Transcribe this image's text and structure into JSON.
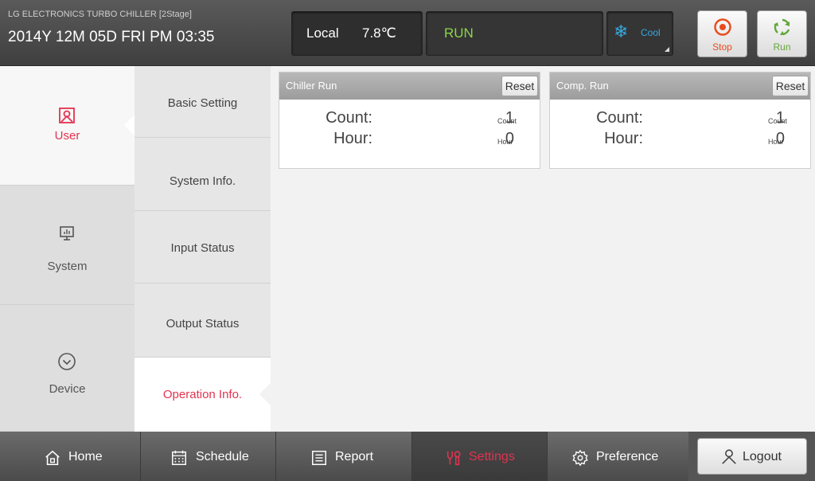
{
  "header": {
    "device_title": "LG ELECTRONICS TURBO CHILLER [2Stage]",
    "datetime": "2014Y 12M 05D  FRI PM 03:35",
    "mode": "Local",
    "temperature": "7.8℃",
    "status": "RUN",
    "operation_mode": "Cool",
    "buttons": {
      "stop_label": "Stop",
      "run_label": "Run"
    }
  },
  "left_nav": {
    "items": [
      {
        "label": "User",
        "icon": "user-icon",
        "active": true
      },
      {
        "label": "System",
        "icon": "monitor-icon",
        "active": false
      },
      {
        "label": "Device",
        "icon": "chevron-circle-icon",
        "active": false
      }
    ]
  },
  "sub_nav": {
    "items": [
      {
        "label": "Basic Setting",
        "active": false
      },
      {
        "label": "System Info.",
        "active": false
      },
      {
        "label": "Input Status",
        "active": false
      },
      {
        "label": "Output Status",
        "active": false
      },
      {
        "label": "Operation Info.",
        "active": true
      }
    ]
  },
  "cards": [
    {
      "title": "Chiller Run",
      "reset_label": "Reset",
      "rows": [
        {
          "label": "Count:",
          "value": "1",
          "unit": "Count"
        },
        {
          "label": "Hour:",
          "value": "0",
          "unit": "Hour"
        }
      ]
    },
    {
      "title": "Comp. Run",
      "reset_label": "Reset",
      "rows": [
        {
          "label": "Count:",
          "value": "1",
          "unit": "Count"
        },
        {
          "label": "Hour:",
          "value": "0",
          "unit": "Hour"
        }
      ]
    }
  ],
  "bottom_nav": {
    "items": [
      {
        "label": "Home",
        "icon": "home-icon",
        "active": false
      },
      {
        "label": "Schedule",
        "icon": "calendar-icon",
        "active": false
      },
      {
        "label": "Report",
        "icon": "report-icon",
        "active": false
      },
      {
        "label": "Settings",
        "icon": "settings-icon",
        "active": true
      },
      {
        "label": "Preference",
        "icon": "gear-icon",
        "active": false
      }
    ],
    "logout_label": "Logout"
  },
  "colors": {
    "accent": "#e2334f",
    "run_green": "#8bd64a",
    "cool_blue": "#35a9e0",
    "stop_orange": "#e94b1d"
  }
}
